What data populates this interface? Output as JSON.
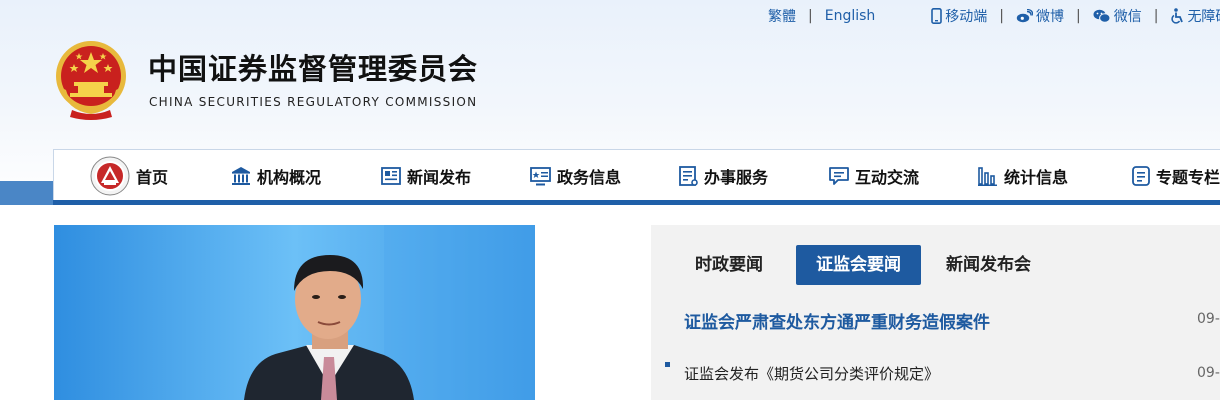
{
  "header": {
    "title_cn": "中国证券监督管理委员会",
    "title_en": "CHINA SECURITIES REGULATORY COMMISSION",
    "toplinks": {
      "traditional": "繁體",
      "english": "English",
      "mobile": "移动端",
      "weibo": "微博",
      "wechat": "微信",
      "accessibility": "无障碍"
    }
  },
  "nav": {
    "items": [
      {
        "label": "首页",
        "icon": "csrc-badge-icon"
      },
      {
        "label": "机构概况",
        "icon": "building-icon"
      },
      {
        "label": "新闻发布",
        "icon": "newspaper-icon"
      },
      {
        "label": "政务信息",
        "icon": "monitor-icon"
      },
      {
        "label": "办事服务",
        "icon": "document-list-icon"
      },
      {
        "label": "互动交流",
        "icon": "chat-icon"
      },
      {
        "label": "统计信息",
        "icon": "bar-chart-icon"
      },
      {
        "label": "专题专栏",
        "icon": "notes-icon"
      }
    ]
  },
  "news": {
    "tabs": [
      {
        "label": "时政要闻",
        "active": false
      },
      {
        "label": "证监会要闻",
        "active": true
      },
      {
        "label": "新闻发布会",
        "active": false
      }
    ],
    "headline": {
      "title": "证监会严肃查处东方通严重财务造假案件",
      "date": "09-"
    },
    "items": [
      {
        "title": "证监会发布《期货公司分类评价规定》",
        "date": "09-"
      }
    ]
  },
  "colors": {
    "brand_blue": "#1e5aa0",
    "link_blue": "#1f5fa8",
    "header_bg": "#e9f1fb",
    "news_bg": "#f2f2f2"
  }
}
